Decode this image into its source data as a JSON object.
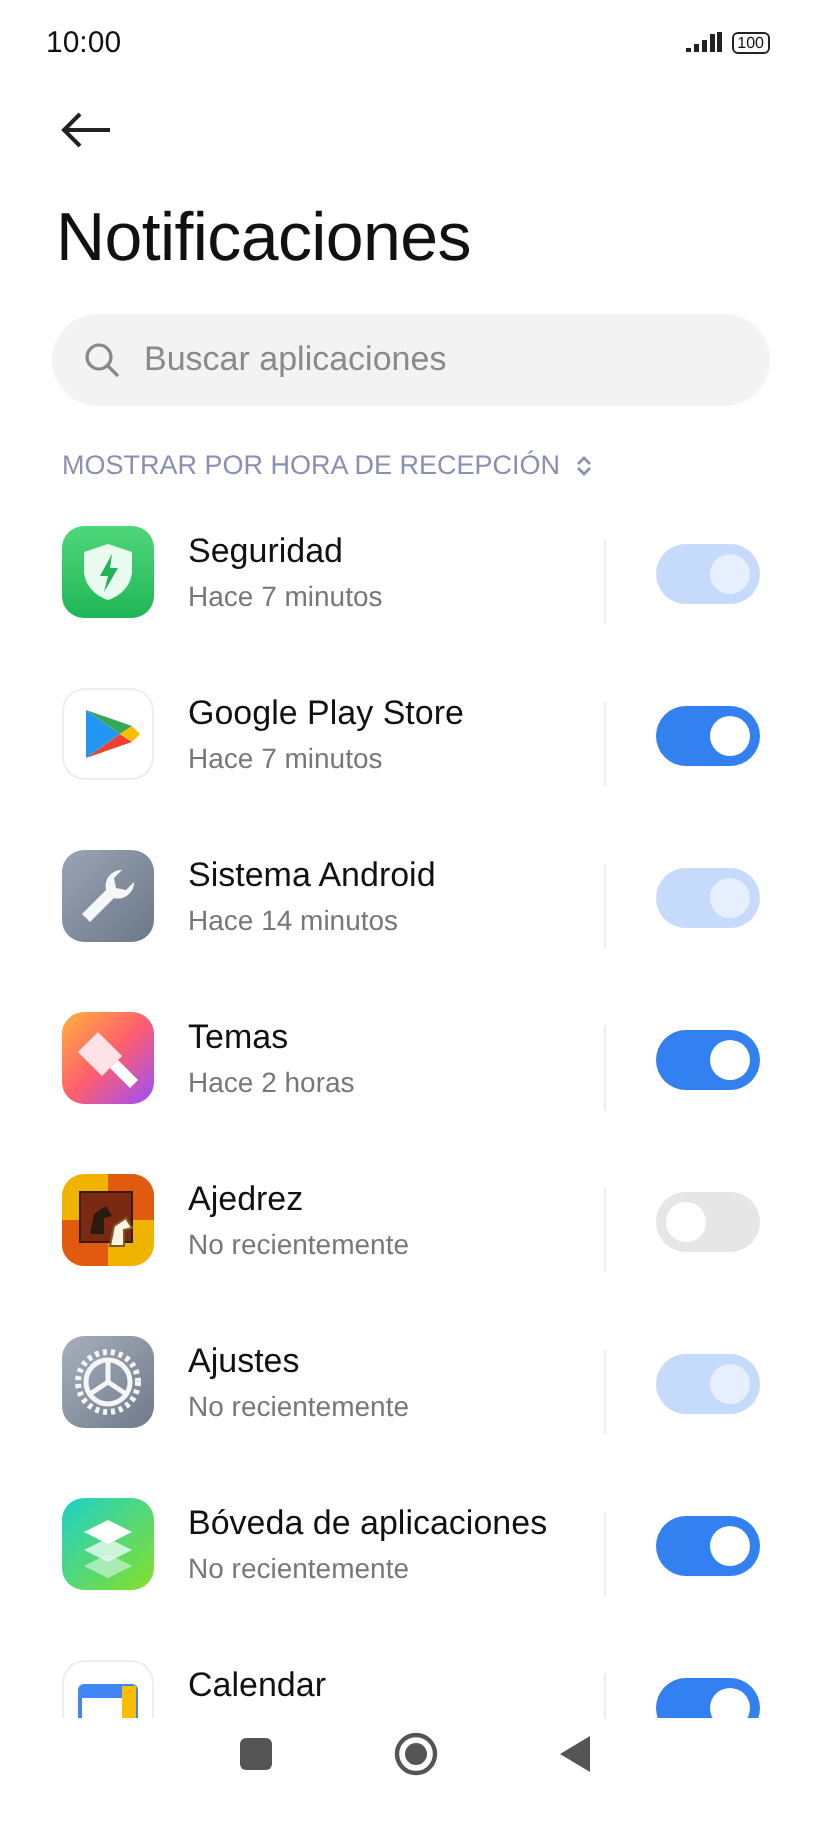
{
  "status_bar": {
    "time": "10:00",
    "battery": "100"
  },
  "title": "Notificaciones",
  "search": {
    "placeholder": "Buscar aplicaciones"
  },
  "sort_label": "MOSTRAR POR HORA DE RECEPCIÓN",
  "apps": [
    {
      "kind": "shield",
      "name": "Seguridad",
      "subtitle": "Hace 7 minutos",
      "on": true,
      "disabled": true
    },
    {
      "kind": "play",
      "name": "Google Play Store",
      "subtitle": "Hace 7 minutos",
      "on": true,
      "disabled": false
    },
    {
      "kind": "wrench",
      "name": "Sistema Android",
      "subtitle": "Hace 14 minutos",
      "on": true,
      "disabled": true
    },
    {
      "kind": "brush",
      "name": "Temas",
      "subtitle": "Hace 2 horas",
      "on": true,
      "disabled": false
    },
    {
      "kind": "chess",
      "name": "Ajedrez",
      "subtitle": "No recientemente",
      "on": false,
      "disabled": false
    },
    {
      "kind": "gear",
      "name": "Ajustes",
      "subtitle": "No recientemente",
      "on": true,
      "disabled": true
    },
    {
      "kind": "layers",
      "name": "Bóveda de aplicaciones",
      "subtitle": "No recientemente",
      "on": true,
      "disabled": false
    },
    {
      "kind": "calendar",
      "name": "Calendar",
      "on": true,
      "disabled": false
    }
  ]
}
